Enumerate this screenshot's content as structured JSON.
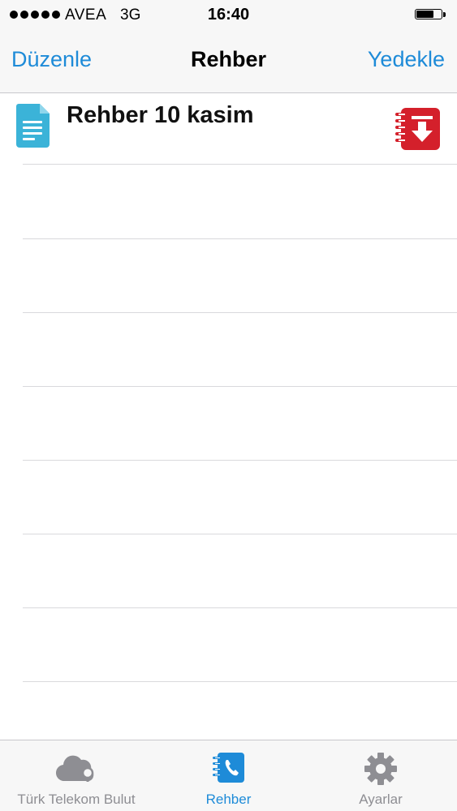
{
  "status_bar": {
    "carrier": "AVEA",
    "network": "3G",
    "time": "16:40",
    "signal_bars": 5,
    "battery_level": 0.7
  },
  "nav": {
    "left_label": "Düzenle",
    "title": "Rehber",
    "right_label": "Yedekle"
  },
  "list": {
    "items": [
      {
        "title": "Rehber 10 kasim",
        "icon": "document-icon",
        "action_icon": "restore-icon"
      }
    ],
    "empty_rows": 7
  },
  "tab_bar": {
    "tabs": [
      {
        "label": "Türk Telekom Bulut",
        "icon": "cloud-icon",
        "active": false
      },
      {
        "label": "Rehber",
        "icon": "contacts-icon",
        "active": true
      },
      {
        "label": "Ayarlar",
        "icon": "gear-icon",
        "active": false
      }
    ]
  },
  "colors": {
    "accent": "#1e8bd8",
    "inactive": "#8e8e93",
    "document_icon": "#3bb3d8",
    "restore_icon": "#d4202b"
  }
}
